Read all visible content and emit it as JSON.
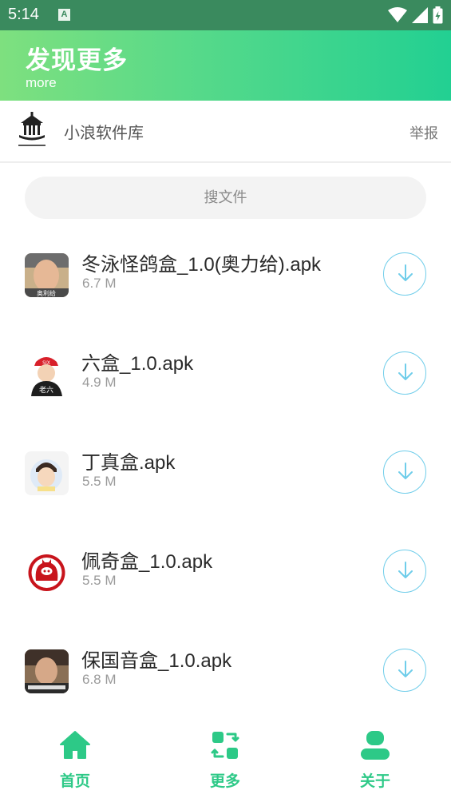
{
  "status_bar": {
    "time": "5:14",
    "notification_letter": "A",
    "icons": [
      "wifi-icon",
      "signal-icon",
      "battery-icon"
    ]
  },
  "header": {
    "title": "发现更多",
    "subtitle": "more"
  },
  "source": {
    "name": "小浪软件库",
    "report_label": "举报",
    "logo_icon": "house-logo-icon"
  },
  "search": {
    "placeholder": "搜文件"
  },
  "files": [
    {
      "name": "冬泳怪鸽盒_1.0(奥力给).apk",
      "size": "6.7 M",
      "icon_caption": "奥利给"
    },
    {
      "name": "六盒_1.0.apk",
      "size": "4.9 M",
      "icon_caption": "老六"
    },
    {
      "name": "丁真盒.apk",
      "size": "5.5 M"
    },
    {
      "name": "佩奇盒_1.0.apk",
      "size": "5.5 M"
    },
    {
      "name": "保国音盒_1.0.apk",
      "size": "6.8 M"
    }
  ],
  "nav": [
    {
      "label": "首页",
      "icon": "home-icon"
    },
    {
      "label": "更多",
      "icon": "swap-icon"
    },
    {
      "label": "关于",
      "icon": "person-icon"
    }
  ],
  "colors": {
    "accent": "#2dc987",
    "header_start": "#7ee07f",
    "header_end": "#22d092",
    "download_ring": "#6fcdea"
  }
}
